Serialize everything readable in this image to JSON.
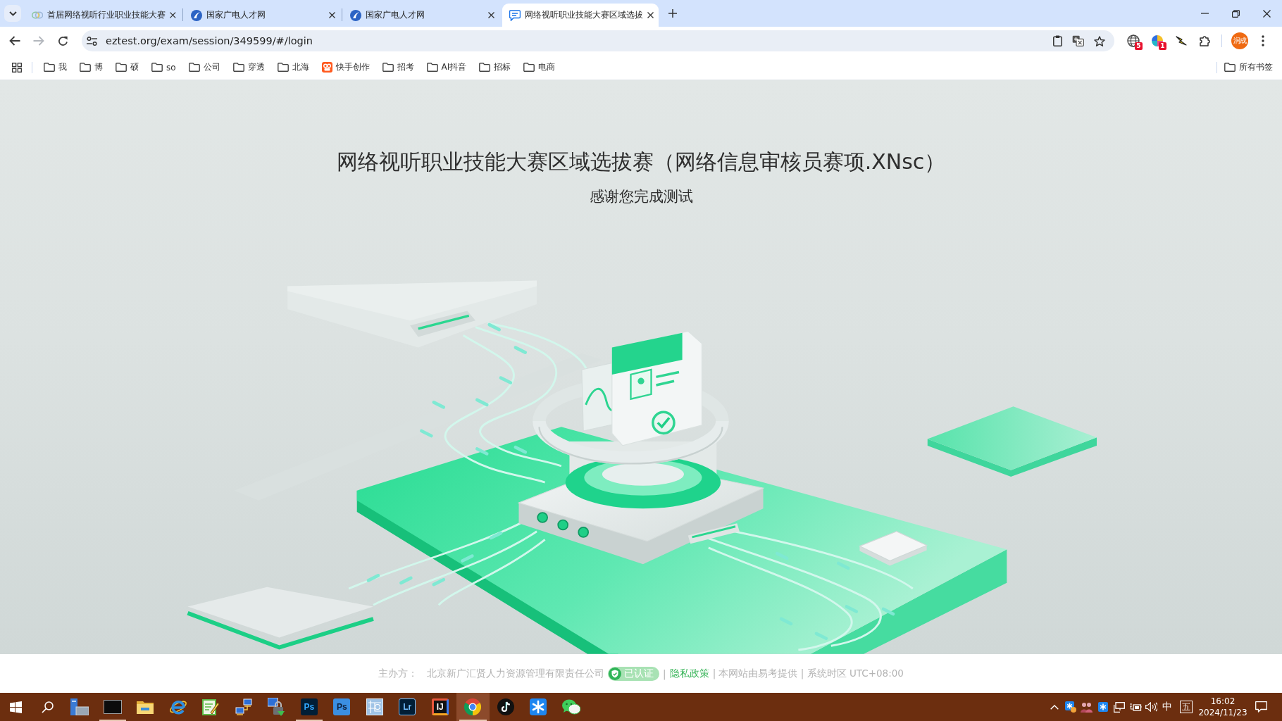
{
  "browser": {
    "tabs": [
      {
        "title": "首届网络视听行业职业技能大赛",
        "selected": false
      },
      {
        "title": "国家广电人才网",
        "selected": false
      },
      {
        "title": "国家广电人才网",
        "selected": false
      },
      {
        "title": "网络视听职业技能大赛区域选拔",
        "selected": true
      }
    ],
    "forward_disabled": true,
    "url": "eztest.org/exam/session/349599/#/login",
    "extension_badges": [
      "5",
      "1"
    ],
    "avatar_text": "润成",
    "bookmarks": [
      {
        "label": "我",
        "kind": "folder"
      },
      {
        "label": "博",
        "kind": "folder"
      },
      {
        "label": "硕",
        "kind": "folder"
      },
      {
        "label": "so",
        "kind": "folder"
      },
      {
        "label": "公司",
        "kind": "folder"
      },
      {
        "label": "穿透",
        "kind": "folder"
      },
      {
        "label": "北海",
        "kind": "folder"
      },
      {
        "label": "快手创作",
        "kind": "app"
      },
      {
        "label": "招考",
        "kind": "folder"
      },
      {
        "label": "AI抖音",
        "kind": "folder"
      },
      {
        "label": "招标",
        "kind": "folder"
      },
      {
        "label": "电商",
        "kind": "folder"
      }
    ],
    "all_bookmarks": "所有书签"
  },
  "page": {
    "title": "网络视听职业技能大赛区域选拔赛（网络信息审核员赛项.XNsc）",
    "subtitle": "感谢您完成测试"
  },
  "footer": {
    "organizer_label": "主办方：",
    "organizer": "北京新广汇贤人力资源管理有限责任公司",
    "verified": "已认证",
    "separator": "|",
    "privacy_link": "隐私政策",
    "notice": "| 本网站由易考提供 | 系统时区 UTC+08:00"
  },
  "taskbar": {
    "apps": [
      {
        "running": false,
        "selected": false
      },
      {
        "running": true,
        "selected": false
      },
      {
        "running": false,
        "selected": false
      },
      {
        "running": false,
        "selected": false
      },
      {
        "running": false,
        "selected": false
      },
      {
        "running": false,
        "selected": false
      },
      {
        "running": false,
        "selected": false
      },
      {
        "glyph": "Ps",
        "running": true,
        "selected": false
      },
      {
        "glyph": "Ps",
        "running": false,
        "selected": false
      },
      {
        "running": false,
        "selected": false
      },
      {
        "glyph": "Lr",
        "running": false,
        "selected": false
      },
      {
        "glyph": "IJ",
        "running": false,
        "selected": false
      },
      {
        "running": true,
        "selected": true
      },
      {
        "running": false,
        "selected": false
      },
      {
        "running": false,
        "selected": false
      },
      {
        "running": false,
        "selected": false
      }
    ],
    "ime_language": "中",
    "ime_mode": "五",
    "time": "16:02",
    "date": "2024/11/23"
  }
}
